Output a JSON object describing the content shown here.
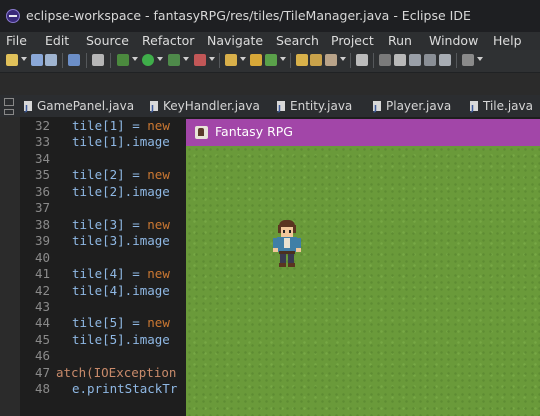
{
  "window": {
    "title": "eclipse-workspace - fantasyRPG/res/tiles/TileManager.java - Eclipse IDE"
  },
  "menubar": {
    "items": [
      "File",
      "Edit",
      "Source",
      "Refactor",
      "Navigate",
      "Search",
      "Project",
      "Run",
      "Window",
      "Help"
    ]
  },
  "editor_tabs": [
    "GamePanel.java",
    "KeyHandler.java",
    "Entity.java",
    "Player.java",
    "Tile.java"
  ],
  "code_lines": [
    {
      "num": "32",
      "pre": "tile[1] = ",
      "kw": "new",
      "post": ""
    },
    {
      "num": "33",
      "pre": "tile[1].image",
      "kw": "",
      "post": ""
    },
    {
      "num": "34",
      "pre": "",
      "kw": "",
      "post": ""
    },
    {
      "num": "35",
      "pre": "tile[2] = ",
      "kw": "new",
      "post": ""
    },
    {
      "num": "36",
      "pre": "tile[2].image",
      "kw": "",
      "post": ""
    },
    {
      "num": "37",
      "pre": "",
      "kw": "",
      "post": ""
    },
    {
      "num": "38",
      "pre": "tile[3] = ",
      "kw": "new",
      "post": ""
    },
    {
      "num": "39",
      "pre": "tile[3].image",
      "kw": "",
      "post": ""
    },
    {
      "num": "40",
      "pre": "",
      "kw": "",
      "post": ""
    },
    {
      "num": "41",
      "pre": "tile[4] = ",
      "kw": "new",
      "post": ""
    },
    {
      "num": "42",
      "pre": "tile[4].image",
      "kw": "",
      "post": ""
    },
    {
      "num": "43",
      "pre": "",
      "kw": "",
      "post": ""
    },
    {
      "num": "44",
      "pre": "tile[5] = ",
      "kw": "new",
      "post": ""
    },
    {
      "num": "45",
      "pre": "tile[5].image",
      "kw": "",
      "post": ""
    },
    {
      "num": "46",
      "pre": "",
      "kw": "",
      "post": ""
    },
    {
      "num": "47",
      "pre": "atch(IOException",
      "kw": "",
      "post": "",
      "catch": true
    },
    {
      "num": "48",
      "pre": "e.printStackTr",
      "kw": "",
      "post": ""
    }
  ],
  "game_window": {
    "title": "Fantasy RPG"
  }
}
